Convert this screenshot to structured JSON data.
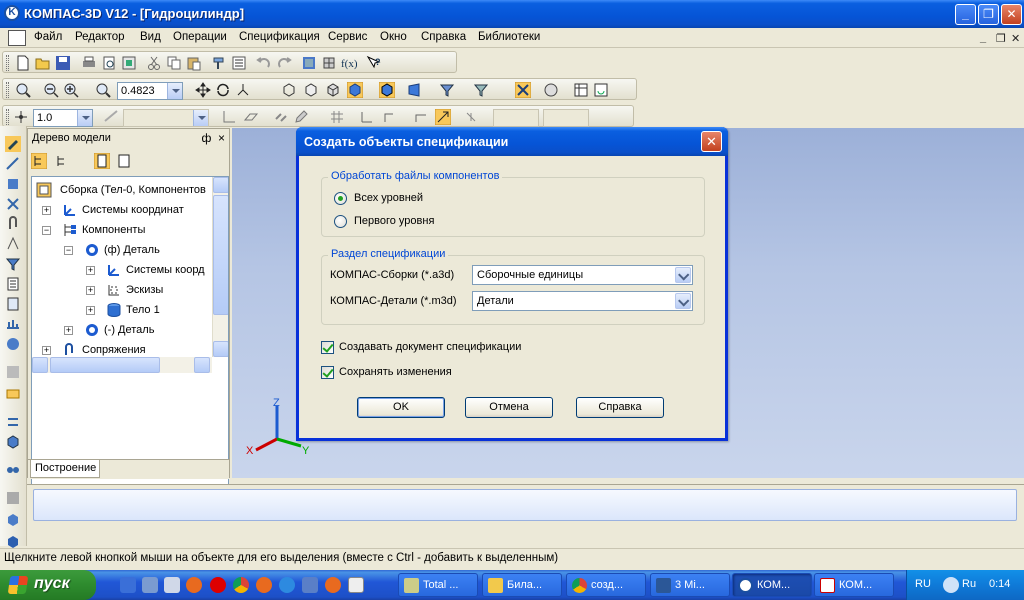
{
  "window": {
    "title": "КОМПАС-3D V12 - [Гидроцилиндр]",
    "app_icon_letter": "K"
  },
  "menu": {
    "items": [
      "Файл",
      "Редактор",
      "Вид",
      "Операции",
      "Спецификация",
      "Сервис",
      "Окно",
      "Справка",
      "Библиотеки"
    ]
  },
  "toolbar": {
    "zoom_value": "0.4823",
    "step_value": "1.0"
  },
  "tree_panel": {
    "title": "Дерево модели",
    "pin": "ф",
    "close": "×",
    "tab": "Построение",
    "rows": [
      {
        "label": "Сборка (Тел-0, Компонентов",
        "exp": "−",
        "icon": "assembly-icon"
      },
      {
        "label": "Системы координат",
        "exp": "+",
        "icon": "coordinate-systems-icon"
      },
      {
        "label": "Компоненты",
        "exp": "−",
        "icon": "components-icon"
      },
      {
        "label": "(ф) Деталь",
        "exp": "−",
        "icon": "part-icon"
      },
      {
        "label": "Системы коорд",
        "exp": "+",
        "icon": "coordinate-systems-icon"
      },
      {
        "label": "Эскизы",
        "exp": "+",
        "icon": "sketch-icon"
      },
      {
        "label": "Тело 1",
        "exp": "+",
        "icon": "body-icon"
      },
      {
        "label": "(-) Деталь",
        "exp": "+",
        "icon": "part-icon"
      },
      {
        "label": "Сопряжения",
        "exp": "+",
        "icon": "mates-icon"
      }
    ]
  },
  "axes": {
    "x": "X",
    "y": "Y",
    "z": "Z"
  },
  "dialog": {
    "title": "Создать объекты спецификации",
    "group1_title": "Обработать файлы компонентов",
    "radio_all": "Всех уровней",
    "radio_first": "Первого уровня",
    "group2_title": "Раздел спецификации",
    "assembly_label": "КОМПАС-Сборки (*.a3d)",
    "assembly_value": "Сборочные единицы",
    "part_label": "КОМПАС-Детали (*.m3d)",
    "part_value": "Детали",
    "check_create": "Создавать документ спецификации",
    "check_save": "Сохранять изменения",
    "ok": "OK",
    "cancel": "Отмена",
    "help": "Справка"
  },
  "status": {
    "text": "Щелкните левой кнопкой мыши на объекте для его выделения (вместе с Ctrl - добавить к выделенным)"
  },
  "taskbar": {
    "start": "пуск",
    "tasks": [
      "Total ...",
      "Била...",
      "созд...",
      "3 Mi...",
      "КОМ...",
      "КОМ..."
    ],
    "language": "RU",
    "lang_indicator": "Ru",
    "time": "0:14"
  },
  "colors": {
    "accent": "#0831d9",
    "legend_text": "#0046d5"
  }
}
